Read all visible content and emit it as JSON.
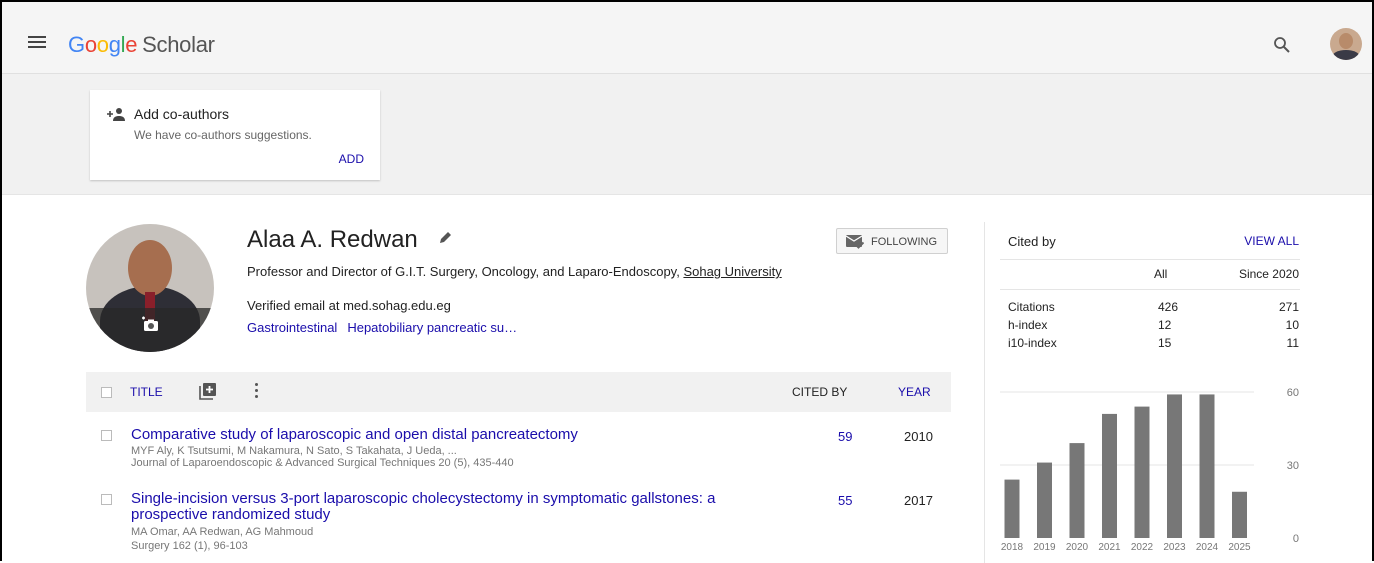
{
  "header": {
    "logo": [
      "G",
      "o",
      "o",
      "g",
      "l",
      "e"
    ],
    "product": "Scholar"
  },
  "coauthors": {
    "title": "Add co-authors",
    "subtitle": "We have co-authors suggestions.",
    "action": "ADD"
  },
  "profile": {
    "name": "Alaa A. Redwan",
    "affiliation_prefix": "Professor and Director of G.I.T. Surgery, Oncology, and Laparo-Endoscopy, ",
    "affiliation_link": "Sohag University",
    "email": "Verified email at med.sohag.edu.eg",
    "interests": [
      "Gastrointestinal",
      "Hepatobiliary pancreatic su…"
    ],
    "follow_label": "FOLLOWING"
  },
  "table": {
    "col_title": "TITLE",
    "col_cited": "CITED BY",
    "col_year": "YEAR",
    "rows": [
      {
        "title": "Comparative study of laparoscopic and open distal pancreatectomy",
        "authors": "MYF Aly, K Tsutsumi, M Nakamura, N Sato, S Takahata, J Ueda, ...",
        "venue": "Journal of Laparoendoscopic & Advanced Surgical Techniques 20 (5), 435-440",
        "cited": "59",
        "year": "2010"
      },
      {
        "title": "Single-incision versus 3-port laparoscopic cholecystectomy in symptomatic gallstones: a prospective randomized study",
        "authors": "MA Omar, AA Redwan, AG Mahmoud",
        "venue": "Surgery 162 (1), 96-103",
        "cited": "55",
        "year": "2017"
      }
    ]
  },
  "cited_by": {
    "title": "Cited by",
    "view_all": "VIEW ALL",
    "col_all": "All",
    "col_since": "Since 2020",
    "metrics": [
      {
        "label": "Citations",
        "all": "426",
        "since": "271"
      },
      {
        "label": "h-index",
        "all": "12",
        "since": "10"
      },
      {
        "label": "i10-index",
        "all": "15",
        "since": "11"
      }
    ]
  },
  "chart_data": {
    "type": "bar",
    "categories": [
      "2018",
      "2019",
      "2020",
      "2021",
      "2022",
      "2023",
      "2024",
      "2025"
    ],
    "values": [
      24,
      31,
      39,
      51,
      54,
      59,
      59,
      19
    ],
    "yticks": [
      0,
      30,
      60
    ],
    "ylim": [
      0,
      60
    ],
    "bar_color": "#777777"
  }
}
